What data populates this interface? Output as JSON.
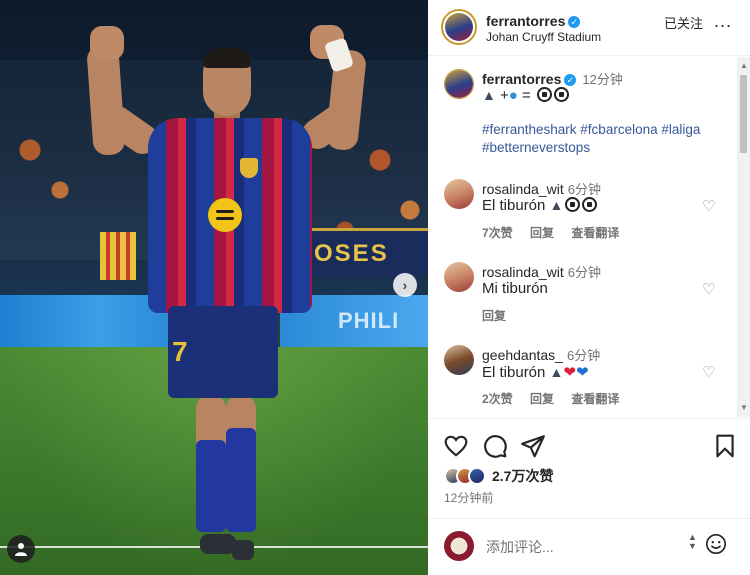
{
  "post": {
    "username": "ferrantorres",
    "location": "Johan Cruyff Stadium",
    "follow_label": "已关注",
    "more_label": "...",
    "photo": {
      "banner_text": "SOSES",
      "board_text": "PHILI",
      "shirt_number": "7"
    }
  },
  "caption": {
    "username": "ferrantorres",
    "time": "12分钟",
    "text_prefix": "+",
    "text_middle": "=",
    "hashtags": "#ferrantheshark #fcbarcelona #laliga #betterneverstops"
  },
  "comments": [
    {
      "username": "rosalinda_wit",
      "time": "6分钟",
      "text": "El tiburón",
      "likes": "7次赞",
      "reply": "回复",
      "translate": "查看翻译"
    },
    {
      "username": "rosalinda_wit",
      "time": "6分钟",
      "text": "Mi tiburón",
      "reply": "回复"
    },
    {
      "username": "geehdantas_",
      "time": "6分钟",
      "text": "El tiburón",
      "likes": "2次赞",
      "reply": "回复",
      "translate": "查看翻译"
    }
  ],
  "actions": {
    "likes": "2.7万次赞",
    "time_ago": "12分钟前"
  },
  "comment_box": {
    "placeholder": "添加评论..."
  },
  "colors": {
    "hashtag": "#385898",
    "verified": "#1d9bf0",
    "muted": "#737373"
  }
}
